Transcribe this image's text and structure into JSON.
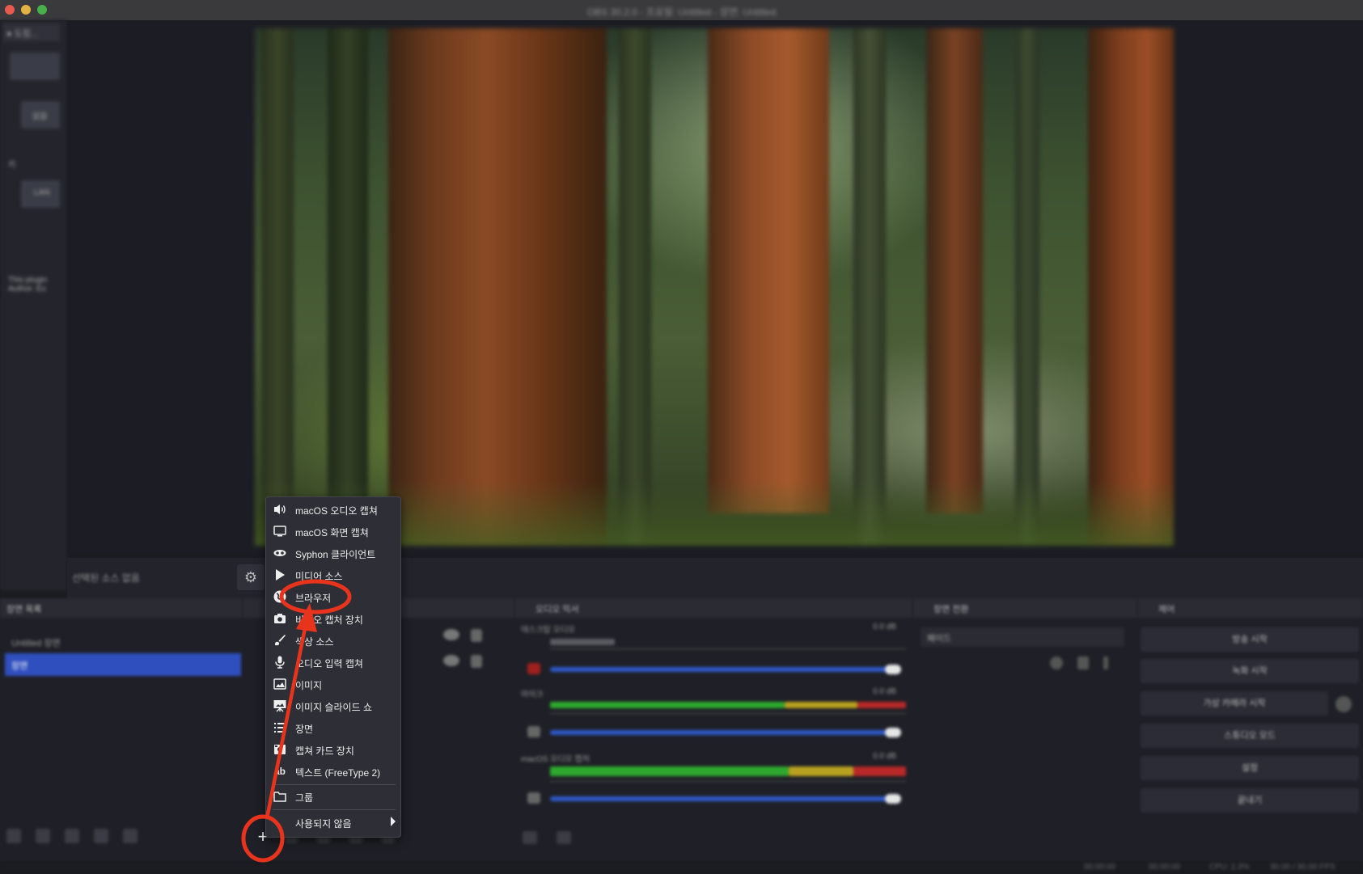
{
  "window": {
    "title": "OBS 30.2.0 - 프로필: Untitled - 장면: Untitled"
  },
  "left_dock": {
    "tab": "● 도킹...",
    "items": [
      "없음",
      "키",
      "LAN"
    ],
    "note": "This plugin Author: Ex"
  },
  "control_strip": {
    "label": "선택된 소스 없음",
    "settings_icon": "gear-icon"
  },
  "scenes_dock": {
    "title": "장면 목록",
    "items": [
      "Untitled 장면",
      "장면"
    ],
    "selected_index": 1
  },
  "sources_dock": {
    "add_icon": "plus-icon"
  },
  "mixer_dock": {
    "title": "오디오 믹서",
    "channels": [
      {
        "name": "데스크탑 오디오",
        "db": "0.0 dB"
      },
      {
        "name": "마이크",
        "db": "0.0 dB"
      },
      {
        "name": "macOS 오디오 캡처",
        "db": "0.0 dB"
      }
    ],
    "colors": {
      "green": "#2ea82e",
      "yellow": "#b8a020",
      "red": "#b82828",
      "slider": "#2f58c8"
    }
  },
  "transitions_dock": {
    "title": "장면 전환",
    "selected": "페이드"
  },
  "controls_dock": {
    "title": "제어",
    "buttons": [
      "방송 시작",
      "녹화 시작",
      "가상 카메라 시작",
      "스튜디오 모드",
      "설정",
      "끝내기"
    ]
  },
  "status_bar": {
    "items": [
      "00:00:00",
      "00:00:00",
      "CPU: 2.3%",
      "30.00 / 30.00 FPS"
    ]
  },
  "context_menu": {
    "items": [
      {
        "icon": "speaker-icon",
        "label": "macOS 오디오 캡쳐"
      },
      {
        "icon": "monitor-icon",
        "label": "macOS 화면 캡쳐"
      },
      {
        "icon": "syphon-icon",
        "label": "Syphon 클라이언트"
      },
      {
        "icon": "play-icon",
        "label": "미디어 소스"
      },
      {
        "icon": "globe-icon",
        "label": "브라우저"
      },
      {
        "icon": "camera-icon",
        "label": "비디오 캡처 장치"
      },
      {
        "icon": "brush-icon",
        "label": "색상 소스"
      },
      {
        "icon": "microphone-icon",
        "label": "오디오 입력 캡쳐"
      },
      {
        "icon": "image-icon",
        "label": "이미지"
      },
      {
        "icon": "slideshow-icon",
        "label": "이미지 슬라이드 쇼"
      },
      {
        "icon": "list-icon",
        "label": "장면"
      },
      {
        "icon": "capture-card-icon",
        "label": "캡쳐 카드 장치"
      },
      {
        "icon": "text-icon",
        "label": "텍스트 (FreeType 2)"
      }
    ],
    "group": {
      "icon": "folder-icon",
      "label": "그룹"
    },
    "deprecated": {
      "label": "사용되지 않음"
    },
    "highlighted": "브라우저",
    "annotation_color": "#e8341c"
  }
}
